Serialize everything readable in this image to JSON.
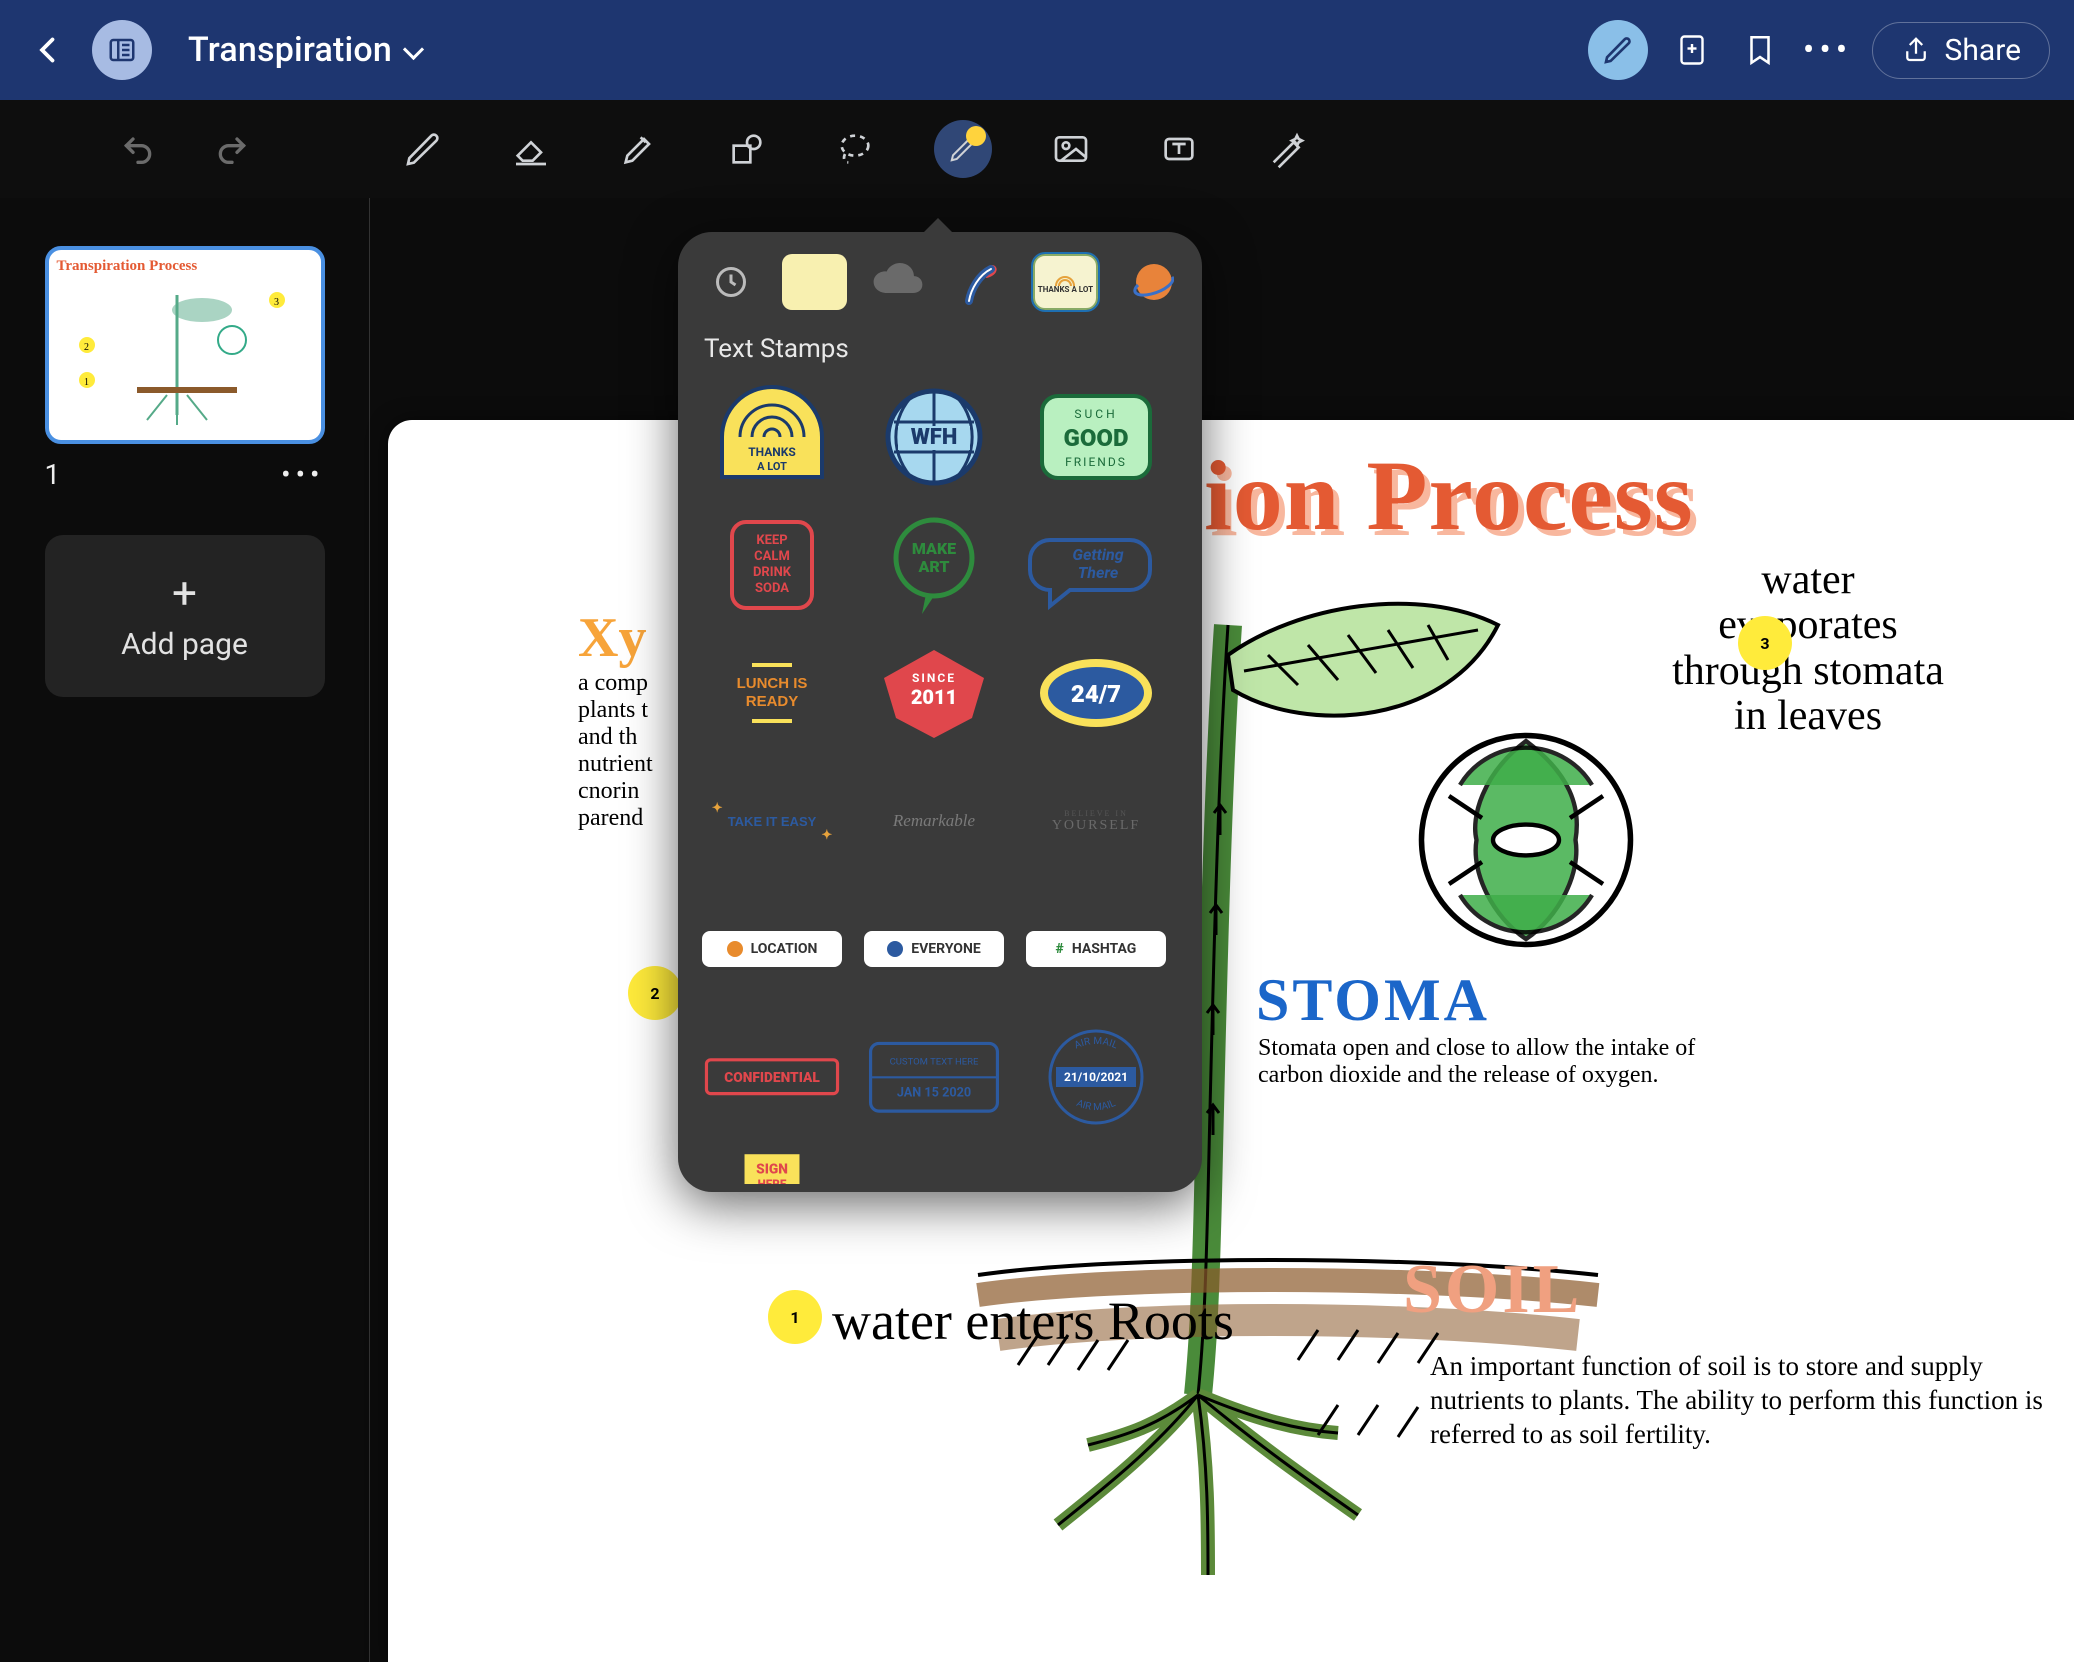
{
  "header": {
    "document_title": "Transpiration",
    "share_label": "Share"
  },
  "toolbar": {
    "tools": [
      "pen",
      "eraser",
      "highlighter",
      "shape",
      "lasso",
      "stickers",
      "image",
      "text",
      "magic"
    ],
    "active": "stickers"
  },
  "sidebar": {
    "page_number": "1",
    "add_page_label": "Add page"
  },
  "canvas": {
    "title_suffix": "ion Process",
    "xylem_label": "Xy",
    "xylem_body": "a comp\nplants t\nand th\nnutrient\ncnorin\nparend",
    "stoma_label": "STOMA",
    "stoma_body": "Stomata open and close to allow the intake of carbon dioxide and the release of oxygen.",
    "soil_label": "SOIL",
    "soil_body": "An important function of soil is to store and supply nutrients to plants. The ability to perform this function is referred to as soil fertility.",
    "step1": "water enters Roots",
    "step3": "water evaporates through stomata in leaves",
    "circ1": "1",
    "circ2": "2",
    "circ3": "3"
  },
  "popover": {
    "section_title": "Text Stamps",
    "tabs": [
      "recent",
      "note",
      "cloud",
      "hearts",
      "text-stamps",
      "space"
    ],
    "selected_tab": "text-stamps",
    "thanks_preview": "THANKS A LOT",
    "stamps": {
      "thanks": {
        "line1": "THANKS",
        "line2": "A LOT"
      },
      "wfh": "WFH",
      "good": {
        "l1": "SUCH",
        "l2": "GOOD",
        "l3": "FRIENDS"
      },
      "keep": "KEEP CALM DRINK SODA",
      "makeart": "MAKE ART",
      "getting": "Getting There",
      "lunch": "LUNCH IS READY",
      "since": {
        "l1": "SINCE",
        "l2": "2011"
      },
      "247": "24/7",
      "easy": "TAKE IT EASY",
      "remark": "Remarkable",
      "yourself": "YOURSELF",
      "location": "LOCATION",
      "everyone": "EVERYONE",
      "hashtag": "HASHTAG",
      "confidential": "CONFIDENTIAL",
      "custom": {
        "l1": "CUSTOM TEXT HERE",
        "l2": "JAN 15 2020"
      },
      "airmail": {
        "l1": "AIR MAIL",
        "l2": "21/10/2021",
        "l3": "AIR MAIL"
      },
      "sign": "SIGN HERE"
    }
  }
}
